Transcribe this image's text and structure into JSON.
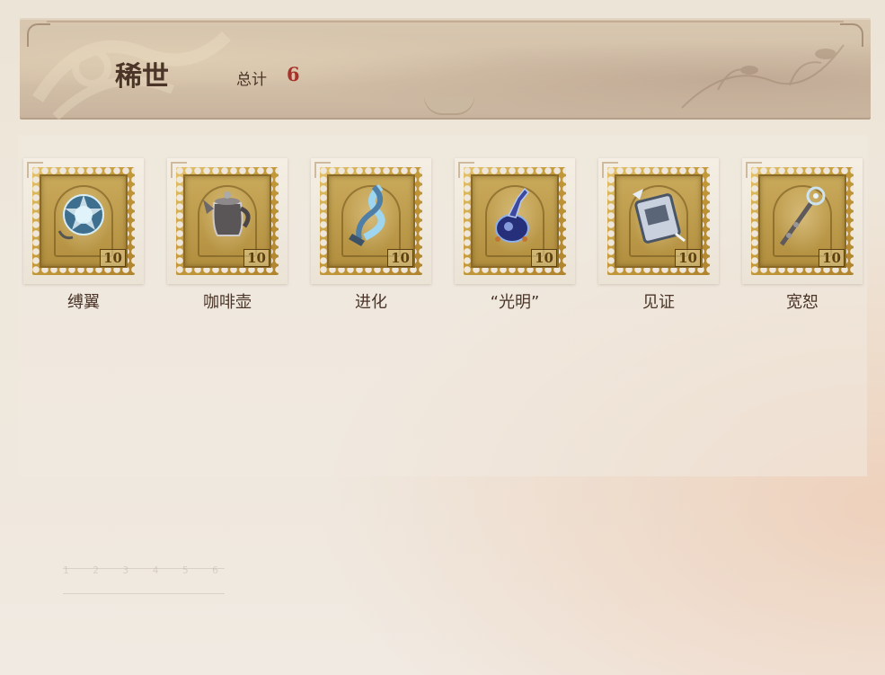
{
  "header": {
    "title": "稀世",
    "total_label": "总计",
    "total_value": "6"
  },
  "items": [
    {
      "name": "缚翼",
      "stamp_number": "10",
      "icon": "winged-orb-icon"
    },
    {
      "name": "咖啡壶",
      "stamp_number": "10",
      "icon": "coffee-pot-icon"
    },
    {
      "name": "进化",
      "stamp_number": "10",
      "icon": "dna-helix-icon"
    },
    {
      "name": "“光明”",
      "stamp_number": "10",
      "icon": "potion-bottle-icon"
    },
    {
      "name": "见证",
      "stamp_number": "10",
      "icon": "witness-frame-icon"
    },
    {
      "name": "宽恕",
      "stamp_number": "10",
      "icon": "scepter-icon"
    }
  ],
  "footer": {
    "ruler_numbers": "1 2 3 4 5 6"
  },
  "colors": {
    "title_text": "#4a3528",
    "count_accent": "#a8312b",
    "stamp_gold": "#c49a3a"
  }
}
